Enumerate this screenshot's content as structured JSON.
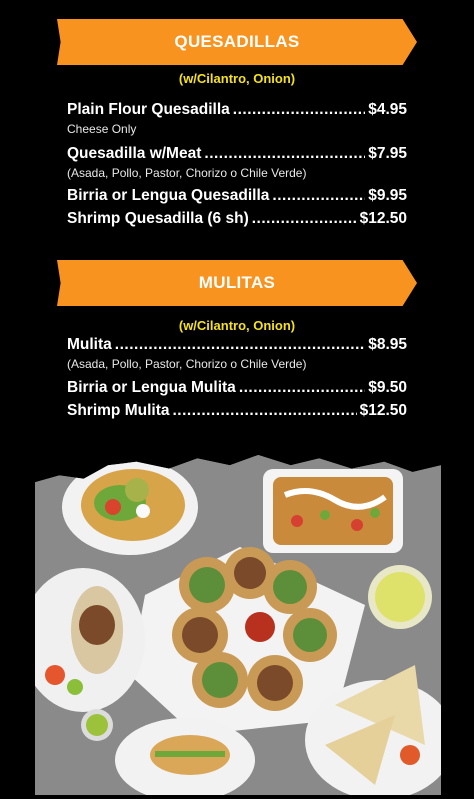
{
  "quesadillas": {
    "title": "QUESADILLAS",
    "subtitle": "(w/Cilantro, Onion)",
    "items": [
      {
        "name": "Plain Flour Quesadilla",
        "price": "$4.95",
        "note": "Cheese Only"
      },
      {
        "name": "Quesadilla w/Meat",
        "price": "$7.95",
        "note": "(Asada, Pollo, Pastor, Chorizo o Chile Verde)"
      },
      {
        "name": "Birria or Lengua Quesadilla",
        "price": "$9.95"
      },
      {
        "name": "Shrimp Quesadilla (6 sh)",
        "price": "$12.50"
      }
    ]
  },
  "mulitas": {
    "title": "MULITAS",
    "subtitle": "(w/Cilantro, Onion)",
    "items": [
      {
        "name": "Mulita",
        "price": "$8.95",
        "note": "(Asada, Pollo, Pastor, Chorizo o Chile Verde)"
      },
      {
        "name": "Birria or Lengua Mulita",
        "price": "$9.50"
      },
      {
        "name": "Shrimp Mulita",
        "price": "$12.50"
      }
    ]
  },
  "colors": {
    "banner": "#f7931e",
    "subtitle": "#f5e11d",
    "background": "#000000"
  }
}
